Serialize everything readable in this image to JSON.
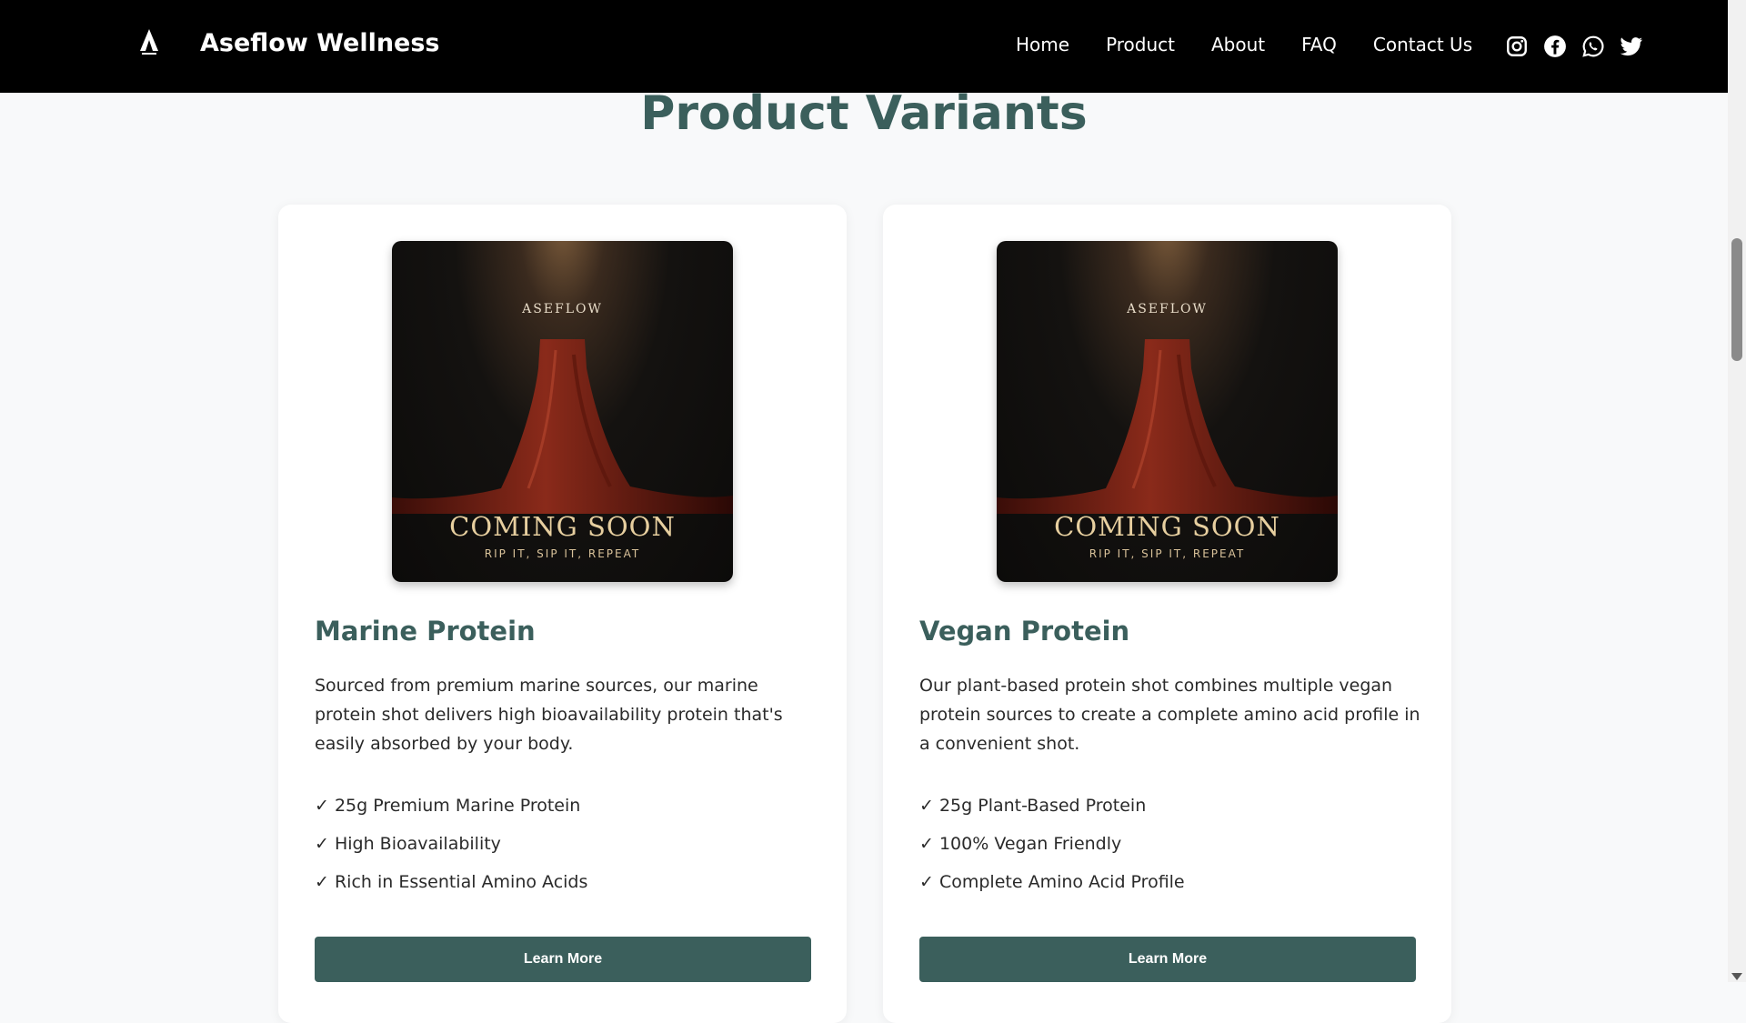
{
  "nav": {
    "brand": "Aseflow Wellness",
    "links": [
      "Home",
      "Product",
      "About",
      "FAQ",
      "Contact Us"
    ],
    "socials": [
      "instagram-icon",
      "facebook-icon",
      "whatsapp-icon",
      "twitter-icon"
    ]
  },
  "section_title": "Product Variants",
  "colors": {
    "accent": "#3b5f5c",
    "nav_bg": "#000000",
    "page_bg": "#f8f9fa",
    "image_gold": "#e7cf9f"
  },
  "cards": [
    {
      "image": {
        "brand": "ASEFLOW",
        "headline": "COMING SOON",
        "tagline": "RIP IT, SIP IT, REPEAT"
      },
      "title": "Marine Protein",
      "description": "Sourced from premium marine sources, our marine protein shot delivers high bioavailability protein that's easily absorbed by your body.",
      "features": [
        "✓ 25g Premium Marine Protein",
        "✓ High Bioavailability",
        "✓ Rich in Essential Amino Acids"
      ],
      "button": "Learn More"
    },
    {
      "image": {
        "brand": "ASEFLOW",
        "headline": "COMING SOON",
        "tagline": "RIP IT, SIP IT, REPEAT"
      },
      "title": "Vegan Protein",
      "description": "Our plant-based protein shot combines multiple vegan protein sources to create a complete amino acid profile in a convenient shot.",
      "features": [
        "✓ 25g Plant-Based Protein",
        "✓ 100% Vegan Friendly",
        "✓ Complete Amino Acid Profile"
      ],
      "button": "Learn More"
    }
  ]
}
